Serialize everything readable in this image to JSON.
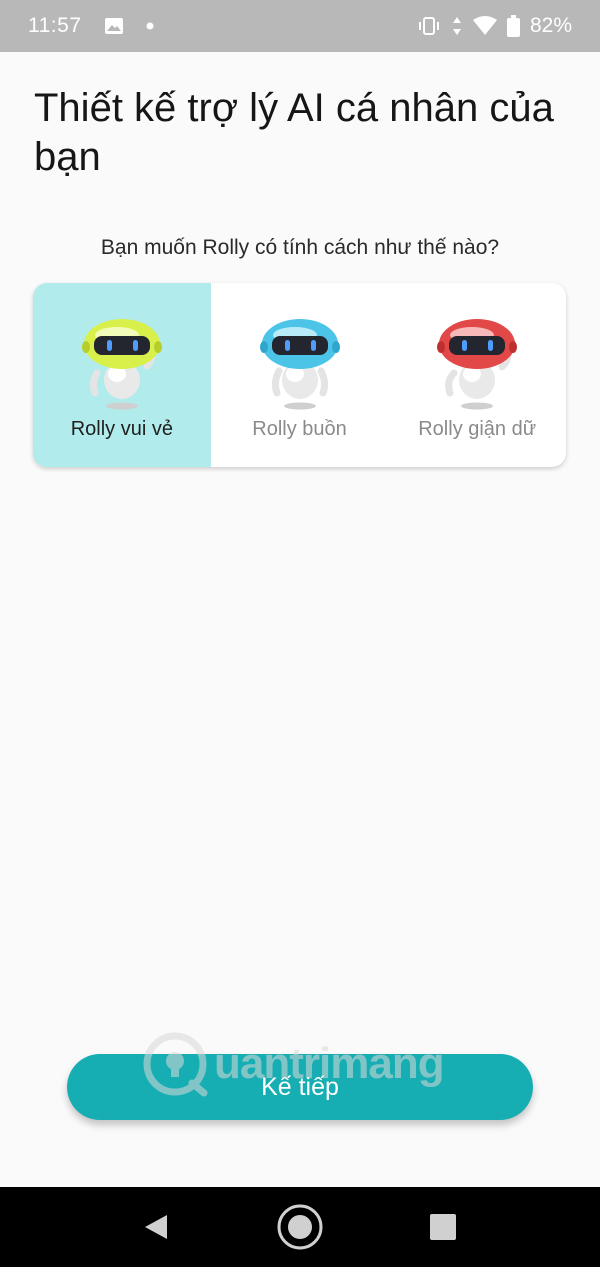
{
  "status_bar": {
    "time": "11:57",
    "battery_percent": "82%",
    "icons": [
      "image-icon",
      "dot-icon",
      "vibrate-icon",
      "data-arrows-icon",
      "wifi-icon",
      "battery-icon"
    ]
  },
  "header": {
    "title": "Thiết kế trợ lý AI cá nhân của bạn"
  },
  "question": "Bạn muốn Rolly có tính cách như thế nào?",
  "personalities": [
    {
      "label": "Rolly vui vẻ",
      "selected": true,
      "head_color": "#d9f04a"
    },
    {
      "label": "Rolly buồn",
      "selected": false,
      "head_color": "#4cc4e8"
    },
    {
      "label": "Rolly giận dữ",
      "selected": false,
      "head_color": "#e24848"
    }
  ],
  "next_button": {
    "label": "Kế tiếp",
    "color": "#16adb3"
  },
  "watermark": {
    "text": "uantrimang"
  },
  "navigation_bar": {
    "icons": [
      "back-icon",
      "home-icon",
      "recents-icon"
    ]
  }
}
